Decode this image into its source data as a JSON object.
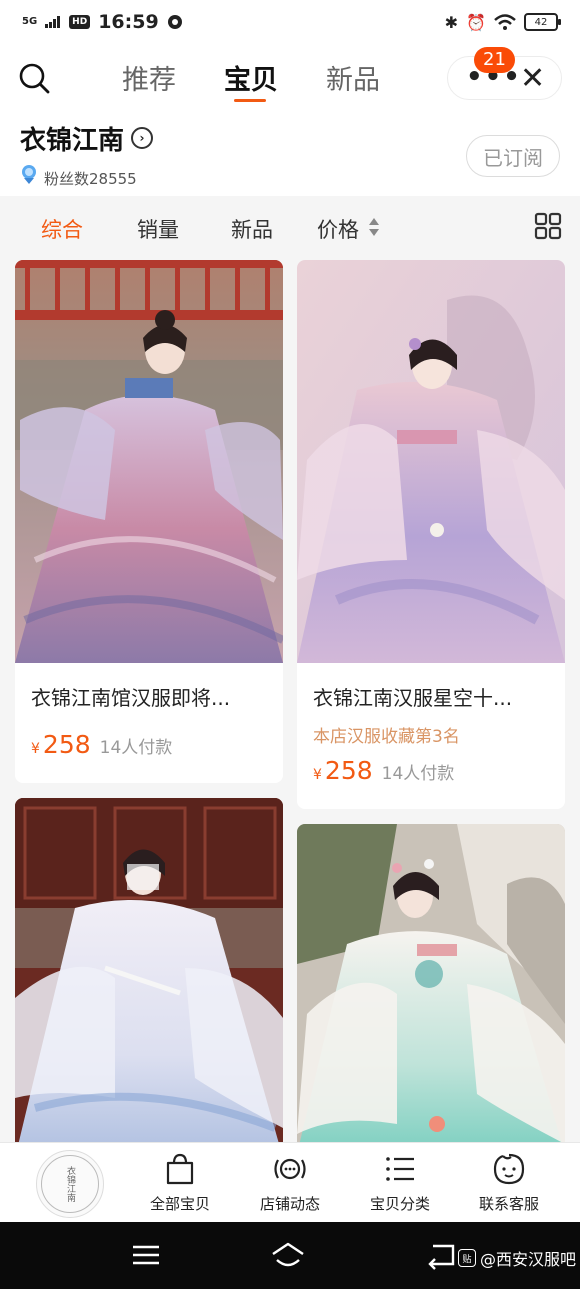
{
  "status_bar": {
    "network": "5G",
    "hd": "HD",
    "time": "16:59",
    "battery": "42"
  },
  "nav": {
    "tabs": [
      {
        "label": "推荐",
        "active": false
      },
      {
        "label": "宝贝",
        "active": true
      },
      {
        "label": "新品",
        "active": false
      }
    ],
    "badge_count": "21"
  },
  "shop": {
    "name": "衣锦江南",
    "fans": "粉丝数28555",
    "subscribe_label": "已订阅"
  },
  "sort": {
    "items": [
      "综合",
      "销量",
      "新品",
      "价格"
    ],
    "active": "综合"
  },
  "products": [
    {
      "title": "衣锦江南馆汉服即将...",
      "rank": "",
      "currency": "¥",
      "price": "258",
      "sold": "14人付款"
    },
    {
      "title": "衣锦江南汉服星空十...",
      "rank": "本店汉服收藏第3名",
      "currency": "¥",
      "price": "258",
      "sold": "14人付款"
    },
    {
      "title": "",
      "rank": "",
      "currency": "",
      "price": "",
      "sold": ""
    },
    {
      "title": "",
      "rank": "",
      "currency": "",
      "price": "",
      "sold": ""
    }
  ],
  "bottom_bar": {
    "logo_text": "衣锦江南",
    "items": [
      {
        "label": "全部宝贝",
        "icon": "shopping-bag-icon"
      },
      {
        "label": "店铺动态",
        "icon": "broadcast-icon"
      },
      {
        "label": "宝贝分类",
        "icon": "category-list-icon"
      },
      {
        "label": "联系客服",
        "icon": "customer-service-icon"
      }
    ]
  },
  "watermark": "@西安汉服吧",
  "colors": {
    "accent": "#f25a13",
    "badge": "#fa4b07",
    "rank_text": "#d99565",
    "feed_bg": "#f5f5f5"
  }
}
